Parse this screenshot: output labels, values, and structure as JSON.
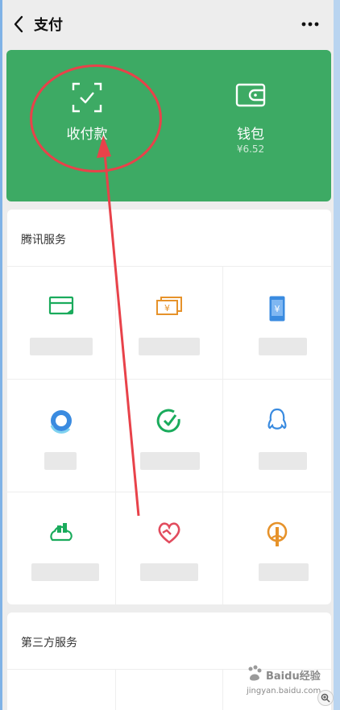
{
  "header": {
    "title": "支付"
  },
  "payment_card": {
    "collect_pay_label": "收付款",
    "wallet_label": "钱包",
    "wallet_balance": "¥6.52"
  },
  "tencent_services": {
    "title": "腾讯服务"
  },
  "third_party_services": {
    "title": "第三方服务"
  },
  "colors": {
    "brand_green": "#3daa64",
    "annotation_red": "#e8424a"
  },
  "watermark": {
    "brand": "Baidu经验",
    "url": "jingyan.baidu.com"
  }
}
